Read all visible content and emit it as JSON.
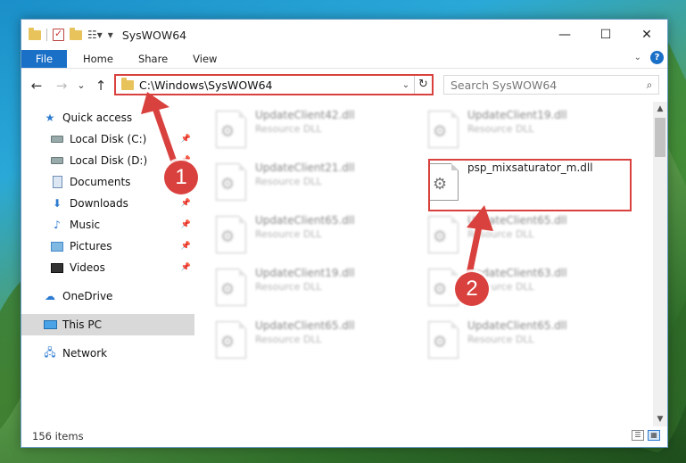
{
  "window": {
    "title": "SysWOW64",
    "controls": {
      "minimize": "—",
      "maximize": "☐",
      "close": "✕"
    }
  },
  "ribbon": {
    "tabs": [
      {
        "label": "File",
        "active": true
      },
      {
        "label": "Home"
      },
      {
        "label": "Share"
      },
      {
        "label": "View"
      }
    ],
    "help": "?"
  },
  "navigation": {
    "back": "←",
    "forward": "→",
    "recent": "⌄",
    "up": "↑",
    "address": "C:\\Windows\\SysWOW64",
    "search_placeholder": "Search SysWOW64"
  },
  "sidebar": {
    "items": [
      {
        "label": "Quick access",
        "icon": "star-icon",
        "level": 1
      },
      {
        "label": "Local Disk (C:)",
        "icon": "drive-icon",
        "level": 2,
        "pinned": true
      },
      {
        "label": "Local Disk (D:)",
        "icon": "drive-icon",
        "level": 2,
        "pinned": true
      },
      {
        "label": "Documents",
        "icon": "documents-icon",
        "level": 2,
        "pinned": true
      },
      {
        "label": "Downloads",
        "icon": "download-icon",
        "level": 2,
        "pinned": true
      },
      {
        "label": "Music",
        "icon": "music-icon",
        "level": 2,
        "pinned": true
      },
      {
        "label": "Pictures",
        "icon": "pictures-icon",
        "level": 2,
        "pinned": true
      },
      {
        "label": "Videos",
        "icon": "videos-icon",
        "level": 2,
        "pinned": true
      },
      {
        "label": "OneDrive",
        "icon": "cloud-icon",
        "level": 1
      },
      {
        "label": "This PC",
        "icon": "computer-icon",
        "level": 1,
        "selected": true
      },
      {
        "label": "Network",
        "icon": "network-icon",
        "level": 1
      }
    ]
  },
  "files": {
    "left_column": [
      {
        "name": "UpdateClient42.dll",
        "type": "Resource DLL"
      },
      {
        "name": "UpdateClient21.dll",
        "type": "Resource DLL"
      },
      {
        "name": "UpdateClient65.dll",
        "type": "Resource DLL"
      },
      {
        "name": "UpdateClient19.dll",
        "type": "Resource DLL"
      },
      {
        "name": "UpdateClient65.dll",
        "type": "Resource DLL"
      }
    ],
    "right_column": [
      {
        "name": "UpdateClient19.dll",
        "type": "Resource DLL"
      },
      {
        "name": "psp_mixsaturator_m.dll",
        "type": "",
        "highlighted": true
      },
      {
        "name": "UpdateClient65.dll",
        "type": "Resource DLL"
      },
      {
        "name": "UpdateClient63.dll",
        "type": "Resource DLL"
      },
      {
        "name": "UpdateClient65.dll",
        "type": "Resource DLL"
      }
    ]
  },
  "status": {
    "item_count": "156 items"
  },
  "annotations": {
    "step1": "1",
    "step2": "2",
    "color": "#d9413e"
  }
}
